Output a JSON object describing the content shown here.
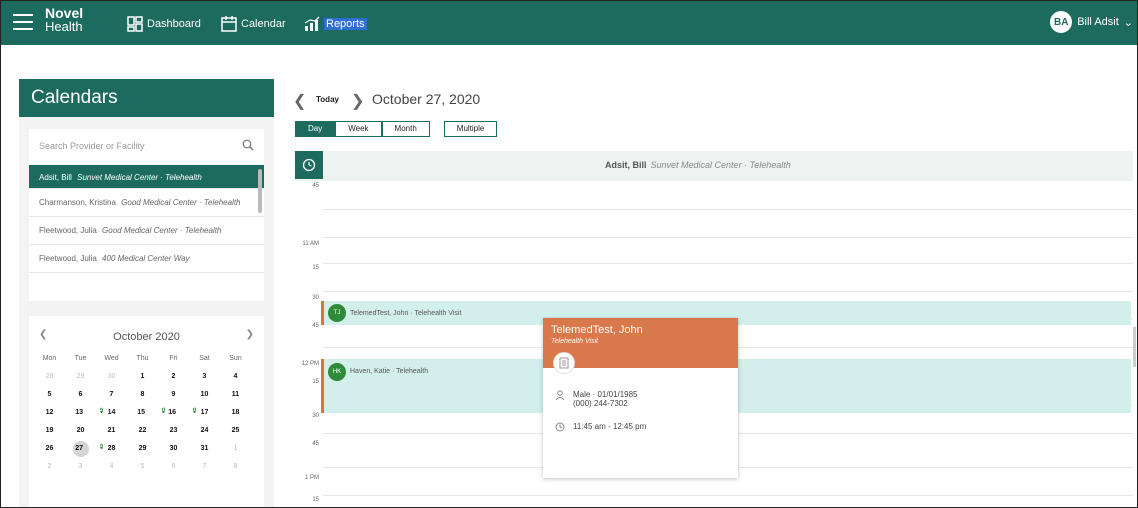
{
  "header": {
    "brand_line1": "Novel",
    "brand_line2": "Health",
    "nav": [
      {
        "label": "Dashboard",
        "icon": "dashboard-icon"
      },
      {
        "label": "Calendar",
        "icon": "calendar-icon"
      },
      {
        "label": "Reports",
        "icon": "reports-icon"
      }
    ],
    "user_initials": "BA",
    "user_name": "Bill Adsit"
  },
  "sidebar": {
    "title": "Calendars",
    "search_placeholder": "Search Provider or Facility",
    "providers": [
      {
        "name": "Adsit, Bill",
        "detail": "Sunvet Medical Center · Telehealth",
        "selected": true
      },
      {
        "name": "Charmanson, Kristina",
        "detail": "Good Medical Center · Telehealth",
        "selected": false
      },
      {
        "name": "Fleetwood, Julia",
        "detail": "Good Medical Center · Telehealth",
        "selected": false
      },
      {
        "name": "Fleetwood, Julia",
        "detail": "400 Medical Center Way",
        "selected": false
      }
    ]
  },
  "mini_calendar": {
    "month": "October 2020",
    "weekdays": [
      "Mon",
      "Tue",
      "Wed",
      "Thu",
      "Fri",
      "Sat",
      "Sun"
    ],
    "days": [
      {
        "d": "28",
        "t": "other"
      },
      {
        "d": "29",
        "t": "other"
      },
      {
        "d": "30",
        "t": "other"
      },
      {
        "d": "1",
        "t": "cur"
      },
      {
        "d": "2",
        "t": "cur"
      },
      {
        "d": "3",
        "t": "cur"
      },
      {
        "d": "4",
        "t": "cur"
      },
      {
        "d": "5",
        "t": "cur"
      },
      {
        "d": "6",
        "t": "cur"
      },
      {
        "d": "7",
        "t": "cur"
      },
      {
        "d": "8",
        "t": "cur"
      },
      {
        "d": "9",
        "t": "cur"
      },
      {
        "d": "10",
        "t": "cur"
      },
      {
        "d": "11",
        "t": "cur"
      },
      {
        "d": "12",
        "t": "cur"
      },
      {
        "d": "13",
        "t": "cur",
        "dot": "2"
      },
      {
        "d": "14",
        "t": "cur"
      },
      {
        "d": "15",
        "t": "cur",
        "dot": "1"
      },
      {
        "d": "16",
        "t": "cur",
        "dot": "1"
      },
      {
        "d": "17",
        "t": "cur"
      },
      {
        "d": "18",
        "t": "cur"
      },
      {
        "d": "19",
        "t": "cur"
      },
      {
        "d": "20",
        "t": "cur"
      },
      {
        "d": "21",
        "t": "cur"
      },
      {
        "d": "22",
        "t": "cur"
      },
      {
        "d": "23",
        "t": "cur"
      },
      {
        "d": "24",
        "t": "cur"
      },
      {
        "d": "25",
        "t": "cur"
      },
      {
        "d": "26",
        "t": "cur"
      },
      {
        "d": "27",
        "t": "cur",
        "today": true,
        "dot": "2"
      },
      {
        "d": "28",
        "t": "cur"
      },
      {
        "d": "29",
        "t": "cur"
      },
      {
        "d": "30",
        "t": "cur"
      },
      {
        "d": "31",
        "t": "cur"
      },
      {
        "d": "1",
        "t": "other"
      },
      {
        "d": "2",
        "t": "other"
      },
      {
        "d": "3",
        "t": "other"
      },
      {
        "d": "4",
        "t": "other"
      },
      {
        "d": "5",
        "t": "other"
      },
      {
        "d": "6",
        "t": "other"
      },
      {
        "d": "7",
        "t": "other"
      },
      {
        "d": "8",
        "t": "other"
      }
    ]
  },
  "calendar": {
    "today_label": "Today",
    "date_label": "October 27, 2020",
    "views": [
      "Day",
      "Week",
      "Month"
    ],
    "active_view": "Day",
    "multiple_label": "Multiple",
    "provider_name": "Adsit, Bill",
    "provider_detail": "Sunvet Medical Center · Telehealth",
    "time_labels": [
      "45",
      "11 AM",
      "15",
      "30",
      "45",
      "12 PM",
      "15",
      "30",
      "45",
      "1 PM",
      "15"
    ],
    "appointments": [
      {
        "initials": "TJ",
        "label": "TelemedTest, John · Telehealth Visit"
      },
      {
        "initials": "HK",
        "label": "Haven, Katie · Telehealth"
      }
    ],
    "popup": {
      "name": "TelemedTest, John",
      "subtitle": "Telehealth Visit",
      "patient_info": "Male · 01/01/1985",
      "phone": "(000) 244-7302",
      "time": "11:45 am - 12:45 pm"
    }
  },
  "colors": {
    "brand": "#1d6b5e",
    "appointment_bg": "#d3efec",
    "accent_orange": "#d9784a",
    "indicator_green": "#2e8b3a"
  }
}
